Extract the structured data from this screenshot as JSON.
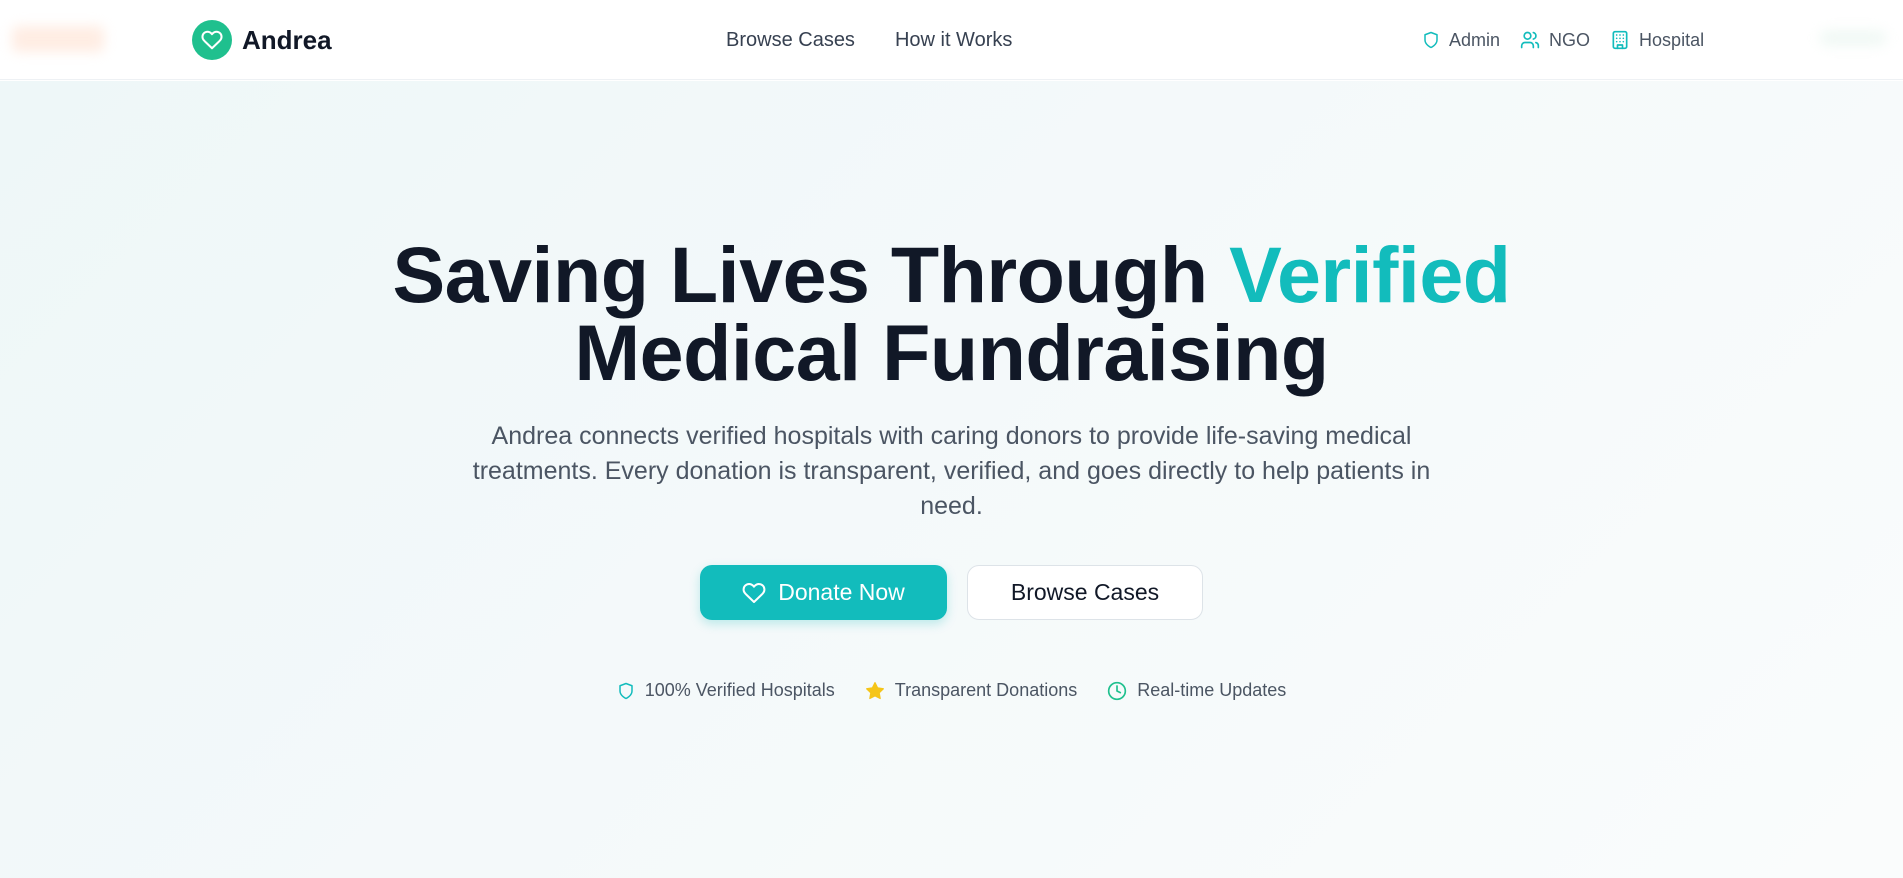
{
  "brand": {
    "name": "Andrea",
    "icon": "heart-icon",
    "color": "#1fc08e"
  },
  "nav": {
    "items": [
      {
        "label": "Browse Cases"
      },
      {
        "label": "How it Works"
      }
    ]
  },
  "roles": [
    {
      "label": "Admin",
      "icon": "shield-icon"
    },
    {
      "label": "NGO",
      "icon": "users-icon"
    },
    {
      "label": "Hospital",
      "icon": "building-icon"
    }
  ],
  "hero": {
    "headline_part1": "Saving Lives Through ",
    "headline_accent": "Verified",
    "headline_part2": "Medical Fundraising",
    "subtitle": "Andrea connects verified hospitals with caring donors to provide life-saving medical treatments. Every donation is transparent, verified, and goes directly to help patients in need.",
    "donate_label": "Donate Now",
    "browse_label": "Browse Cases"
  },
  "features": [
    {
      "label": "100% Verified Hospitals",
      "icon": "shield-icon"
    },
    {
      "label": "Transparent Donations",
      "icon": "star-icon"
    },
    {
      "label": "Real-time Updates",
      "icon": "clock-icon"
    }
  ],
  "colors": {
    "accent": "#12bcbc",
    "brand_green": "#1fc08e",
    "star": "#f5c518",
    "text_dark": "#111827"
  }
}
